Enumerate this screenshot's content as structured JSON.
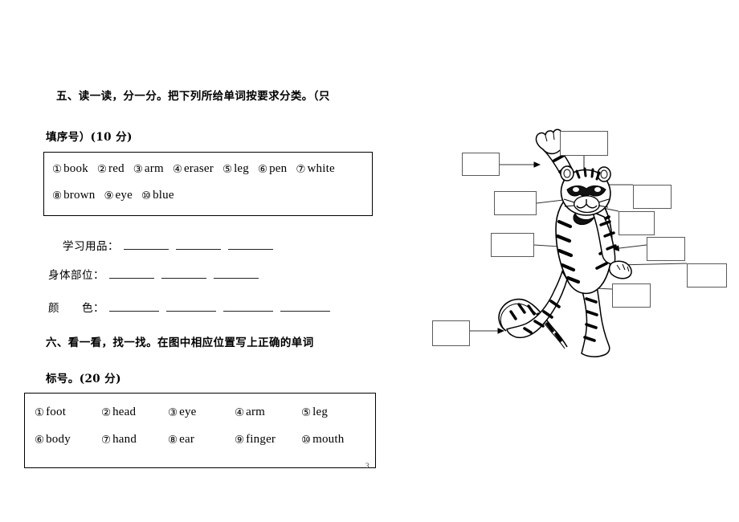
{
  "document": {
    "page_number": "3"
  },
  "section_five": {
    "heading_line1": "五、读一读，分一分。把下列所给单词按要求分类。（只",
    "heading_line2": "填序号）(10 分)",
    "word_bank": {
      "row_a": [
        {
          "num": "①",
          "word": "book"
        },
        {
          "num": "②",
          "word": "red"
        },
        {
          "num": "③",
          "word": "arm"
        },
        {
          "num": "④",
          "word": "eraser"
        },
        {
          "num": "⑤",
          "word": "leg"
        },
        {
          "num": "⑥",
          "word": "pen"
        },
        {
          "num": "⑦",
          "word": "white"
        }
      ],
      "row_b": [
        {
          "num": "⑧",
          "word": "brown"
        },
        {
          "num": "⑨",
          "word": "eye"
        },
        {
          "num": "⑩",
          "word": "blue"
        }
      ]
    },
    "categories": [
      {
        "label": "学习用品",
        "colon": "：",
        "blanks": 3
      },
      {
        "label": "身体部位",
        "colon": "：",
        "blanks": 3
      },
      {
        "label": "颜　　色",
        "colon": "：",
        "blanks": 4
      }
    ]
  },
  "section_six": {
    "heading_line1": "六、看一看，找一找。在图中相应位置写上正确的单词",
    "heading_line2": "标号。(20 分)",
    "word_bank": {
      "row_a": [
        {
          "num": "①",
          "word": "foot"
        },
        {
          "num": "②",
          "word": "head"
        },
        {
          "num": "③",
          "word": "eye"
        },
        {
          "num": "④",
          "word": "arm"
        },
        {
          "num": "⑤",
          "word": "leg"
        }
      ],
      "row_b": [
        {
          "num": "⑥",
          "word": "body"
        },
        {
          "num": "⑦",
          "word": "hand"
        },
        {
          "num": "⑧",
          "word": "ear"
        },
        {
          "num": "⑨",
          "word": "finger"
        },
        {
          "num": "⑩",
          "word": "mouth"
        }
      ]
    },
    "diagram": {
      "image_name": "cartoon-tiger-illustration",
      "box_border_color": "#5a5a5a",
      "answer_boxes": [
        {
          "name": "label-box-head",
          "value": ""
        },
        {
          "name": "label-box-hand",
          "value": ""
        },
        {
          "name": "label-box-ear",
          "value": ""
        },
        {
          "name": "label-box-eye",
          "value": ""
        },
        {
          "name": "label-box-mouth",
          "value": ""
        },
        {
          "name": "label-box-body",
          "value": ""
        },
        {
          "name": "label-box-arm",
          "value": ""
        },
        {
          "name": "label-box-finger",
          "value": ""
        },
        {
          "name": "label-box-leg",
          "value": ""
        },
        {
          "name": "label-box-foot",
          "value": ""
        },
        {
          "name": "label-box-tail",
          "value": ""
        }
      ]
    }
  }
}
